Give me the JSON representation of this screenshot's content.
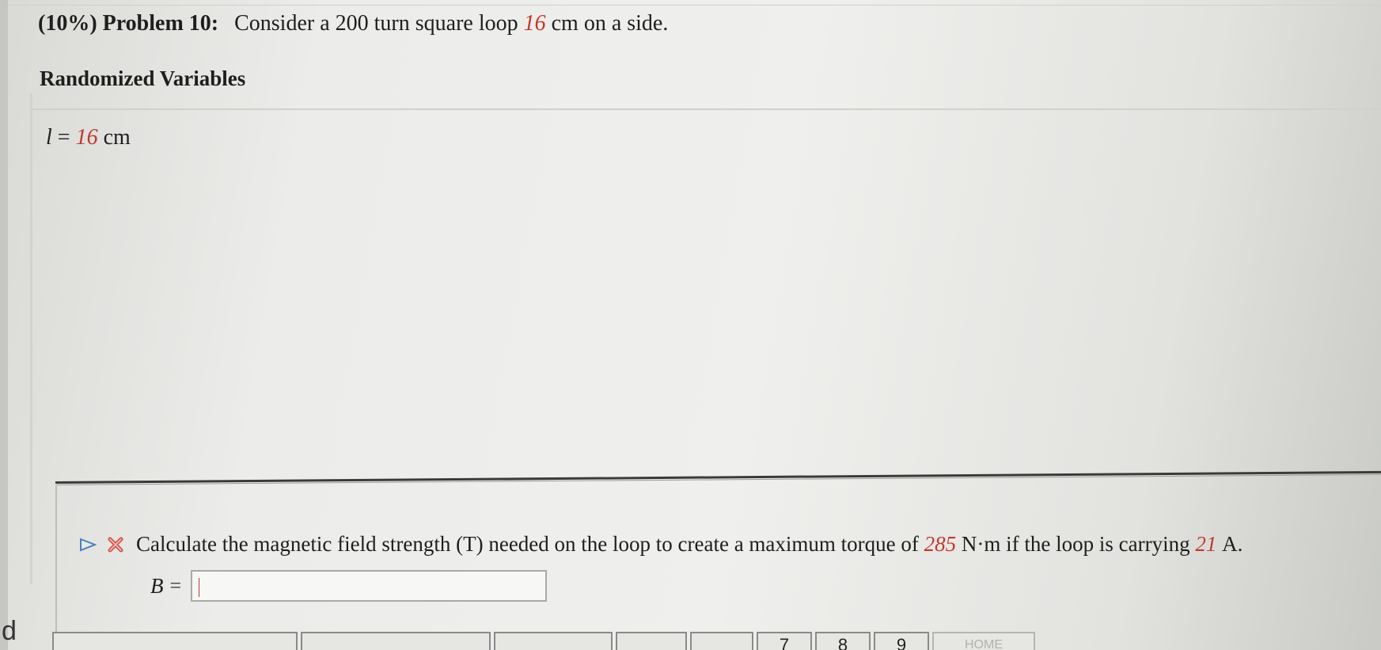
{
  "problem": {
    "prefix": "(10%) Problem 10:",
    "text_before": "Consider a 200 turn square loop",
    "side_value": "16",
    "text_after": "cm on a side."
  },
  "randomized": {
    "heading": "Randomized Variables",
    "var_symbol": "l",
    "var_eq": "=",
    "var_value": "16",
    "var_unit": "cm"
  },
  "question": {
    "text_before": "Calculate the magnetic field strength (T) needed on the loop to create a maximum torque of",
    "torque_value": "285",
    "text_middle": "N·m if the loop is carrying",
    "current_value": "21",
    "text_after": "A."
  },
  "answer": {
    "label": "B",
    "equals": "=",
    "value": ""
  },
  "side_fragment": "d",
  "keypad": {
    "keys": [
      "",
      "",
      "",
      "",
      "",
      "7",
      "8",
      "9",
      "HOME"
    ]
  },
  "colors": {
    "highlight_red": "#c0392b",
    "status_x_icon": "#d4534a"
  },
  "icons": [
    "play-arrow-icon",
    "incorrect-x-icon"
  ]
}
